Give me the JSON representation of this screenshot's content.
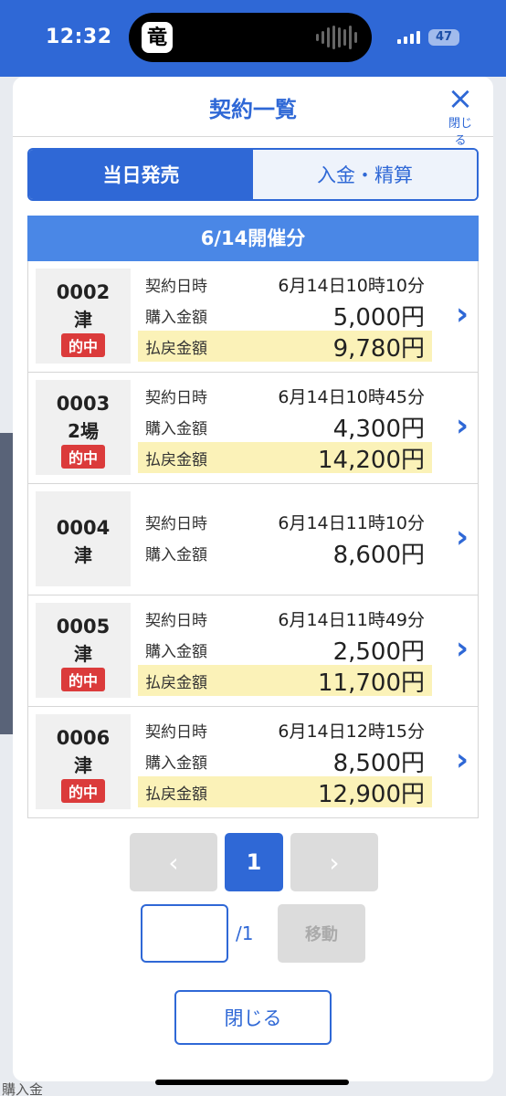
{
  "status_bar": {
    "time": "12:32",
    "battery": "47",
    "app_glyph": "竜"
  },
  "modal": {
    "title": "契約一覧",
    "close_label": "閉じる",
    "tabs": [
      {
        "label": "当日発売",
        "active": true
      },
      {
        "label": "入金・精算",
        "active": false
      }
    ],
    "group_header": "6/14開催分",
    "labels": {
      "contract_time": "契約日時",
      "purchase": "購入金額",
      "payout": "払戻金額"
    },
    "rows": [
      {
        "id": "0002",
        "place": "津",
        "badge": "的中",
        "time": "6月14日10時10分",
        "purchase": "5,000円",
        "payout": "9,780円"
      },
      {
        "id": "0003",
        "place": "2場",
        "badge": "的中",
        "time": "6月14日10時45分",
        "purchase": "4,300円",
        "payout": "14,200円"
      },
      {
        "id": "0004",
        "place": "津",
        "badge": "",
        "time": "6月14日11時10分",
        "purchase": "8,600円",
        "payout": ""
      },
      {
        "id": "0005",
        "place": "津",
        "badge": "的中",
        "time": "6月14日11時49分",
        "purchase": "2,500円",
        "payout": "11,700円"
      },
      {
        "id": "0006",
        "place": "津",
        "badge": "的中",
        "time": "6月14日12時15分",
        "purchase": "8,500円",
        "payout": "12,900円"
      }
    ],
    "pagination": {
      "prev": "‹",
      "current": "1",
      "next": "›",
      "total": "/1",
      "move_label": "移動",
      "page_input": ""
    },
    "close_button": "閉じる"
  },
  "background": {
    "partial_text": "購入金"
  },
  "colors": {
    "accent": "#2f68d6",
    "hit_badge": "#db3b3b",
    "payout_bg": "#fbf2b8"
  }
}
